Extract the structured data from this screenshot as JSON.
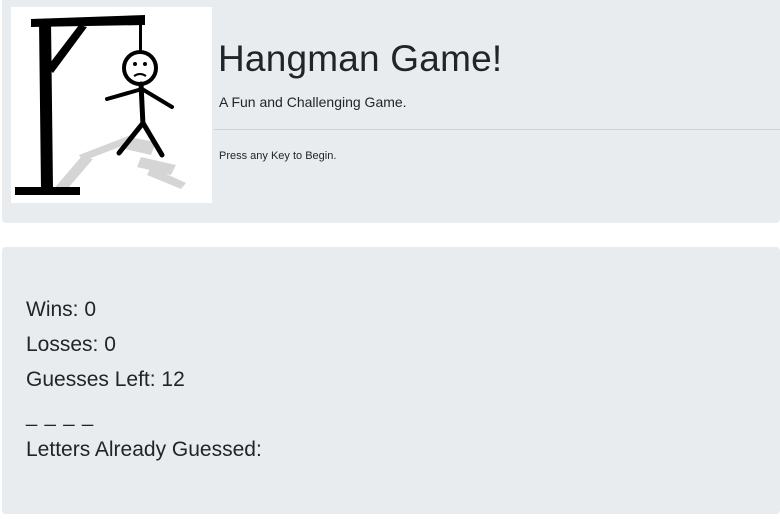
{
  "header": {
    "title": "Hangman Game!",
    "subtitle": "A Fun and Challenging Game.",
    "instruction": "Press any Key to Begin.",
    "logo_icon": "hangman-gallows-icon"
  },
  "stats": {
    "wins_label": "Wins:",
    "wins_value": "0",
    "losses_label": "Losses:",
    "losses_value": "0",
    "guesses_left_label": "Guesses Left:",
    "guesses_left_value": "12",
    "word_blanks": "_ _ _ _",
    "letters_guessed_label": "Letters Already Guessed:",
    "letters_guessed_value": ""
  },
  "colors": {
    "panel_background": "#e9ecef",
    "text": "#212529",
    "page_background": "#ffffff"
  }
}
